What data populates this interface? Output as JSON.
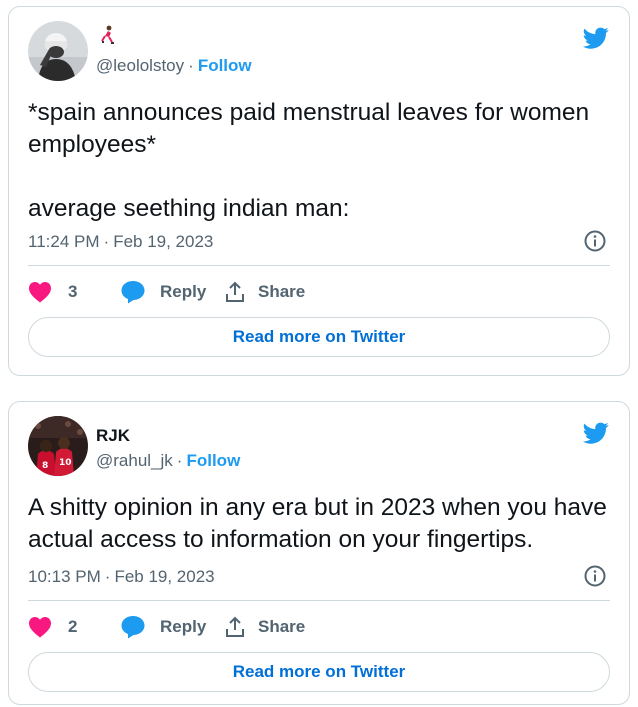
{
  "tweets": [
    {
      "display_name": "",
      "name_emoji": "runner-emoji",
      "handle": "@leololstoy",
      "separator": "·",
      "follow_label": "Follow",
      "text_lines": [
        "*spain announces paid menstrual leaves for women employees*",
        "average seething indian man:"
      ],
      "time": "11:24 PM",
      "date": "Feb 19, 2023",
      "like_count": "3",
      "reply_label": "Reply",
      "share_label": "Share",
      "read_more_label": "Read more on Twitter"
    },
    {
      "display_name": "RJK",
      "handle": "@rahul_jk",
      "separator": "·",
      "follow_label": "Follow",
      "text_lines": [
        "A shitty opinion in any era but in 2023 when you have actual access to information on your fingertips."
      ],
      "time": "10:13 PM",
      "date": "Feb 19, 2023",
      "like_count": "2",
      "reply_label": "Reply",
      "share_label": "Share",
      "read_more_label": "Read more on Twitter"
    }
  ],
  "colors": {
    "twitter_blue": "#1d9bf0",
    "link_blue": "#006fd6",
    "heart_pink": "#f91880",
    "text": "#0f1419",
    "muted": "#536471",
    "border": "#cfd9de"
  },
  "icons": {
    "bird": "twitter-bird-icon",
    "heart": "heart-icon",
    "reply": "speech-bubble-icon",
    "share": "share-upload-icon",
    "info": "info-icon"
  }
}
